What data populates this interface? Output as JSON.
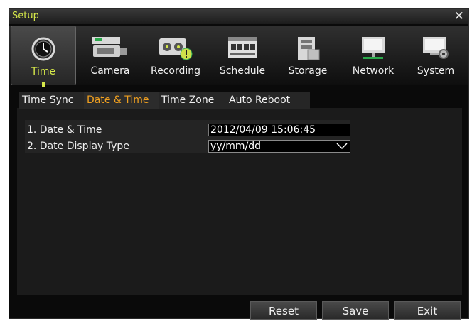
{
  "window": {
    "title": "Setup",
    "close_glyph": "✕"
  },
  "toolbar": {
    "items": [
      {
        "label": "Time",
        "icon": "clock-icon",
        "active": true
      },
      {
        "label": "Camera",
        "icon": "camera-icon"
      },
      {
        "label": "Recording",
        "icon": "recording-icon"
      },
      {
        "label": "Schedule",
        "icon": "schedule-icon"
      },
      {
        "label": "Storage",
        "icon": "storage-icon"
      },
      {
        "label": "Network",
        "icon": "network-icon"
      },
      {
        "label": "System",
        "icon": "system-icon"
      }
    ]
  },
  "subtabs": [
    {
      "label": "Time Sync"
    },
    {
      "label": "Date & Time",
      "active": true
    },
    {
      "label": "Time Zone"
    },
    {
      "label": "Auto Reboot"
    }
  ],
  "rows": [
    {
      "label": "1. Date & Time",
      "value": "2012/04/09  15:06:45"
    },
    {
      "label": "2. Date Display Type",
      "value": "yy/mm/dd"
    }
  ],
  "buttons": {
    "reset": "Reset",
    "save": "Save",
    "exit": "Exit"
  },
  "colors": {
    "accent": "#d6e84a",
    "active_tab": "#f0a020"
  }
}
